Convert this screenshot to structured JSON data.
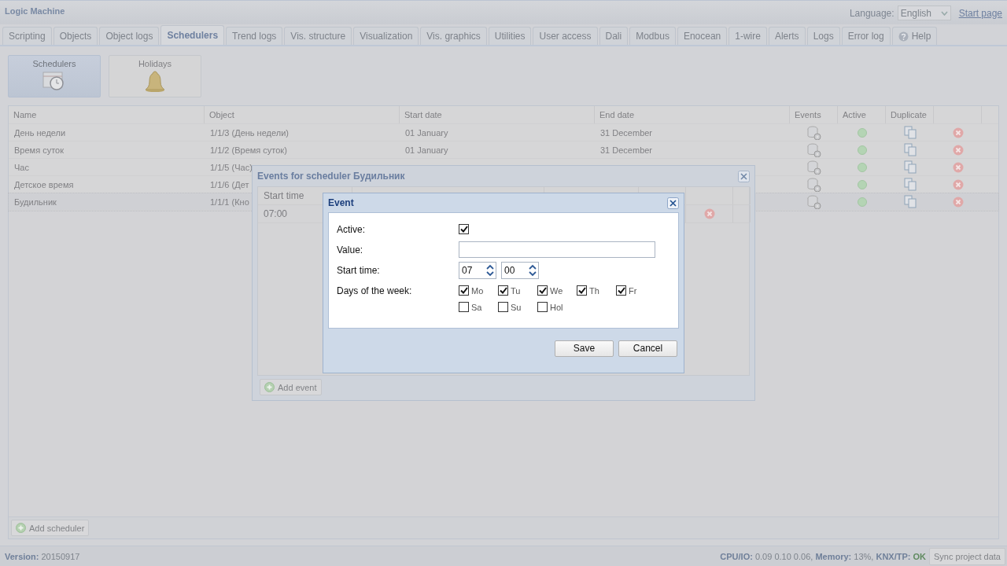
{
  "app_title": "Logic Machine",
  "language": {
    "label": "Language:",
    "value": "English"
  },
  "start_page": "Start page",
  "tabs": [
    {
      "label": "Scripting",
      "selected": false,
      "kind": "plain"
    },
    {
      "label": "Objects",
      "selected": false,
      "kind": "plain"
    },
    {
      "label": "Object logs",
      "selected": false,
      "kind": "plain"
    },
    {
      "label": "Schedulers",
      "selected": true,
      "kind": "plain"
    },
    {
      "label": "Trend logs",
      "selected": false,
      "kind": "plain"
    },
    {
      "label": "Vis. structure",
      "selected": false,
      "kind": "plain"
    },
    {
      "label": "Visualization",
      "selected": false,
      "kind": "plain"
    },
    {
      "label": "Vis. graphics",
      "selected": false,
      "kind": "plain"
    },
    {
      "label": "Utilities",
      "selected": false,
      "kind": "plain"
    },
    {
      "label": "User access",
      "selected": false,
      "kind": "plain"
    },
    {
      "label": "Dali",
      "selected": false,
      "kind": "plain"
    },
    {
      "label": "Modbus",
      "selected": false,
      "kind": "plain"
    },
    {
      "label": "Enocean",
      "selected": false,
      "kind": "plain"
    },
    {
      "label": "1-wire",
      "selected": false,
      "kind": "plain"
    },
    {
      "label": "Alerts",
      "selected": false,
      "kind": "plain"
    },
    {
      "label": "Logs",
      "selected": false,
      "kind": "plain"
    },
    {
      "label": "Error log",
      "selected": false,
      "kind": "plain"
    },
    {
      "label": "Help",
      "selected": false,
      "kind": "help"
    }
  ],
  "modules": [
    {
      "label": "Schedulers",
      "selected": true,
      "kind": "calendar"
    },
    {
      "label": "Holidays",
      "selected": false,
      "kind": "bell"
    }
  ],
  "table": {
    "columns": [
      "Name",
      "Object",
      "Start date",
      "End date",
      "Events",
      "Active",
      "Duplicate"
    ],
    "rows": [
      {
        "name": "День недели",
        "object": "1/1/3 (День недели)",
        "start_date": "01 January",
        "end_date": "31 December",
        "active": true,
        "selected": false
      },
      {
        "name": "Время суток",
        "object": "1/1/2 (Время суток)",
        "start_date": "01 January",
        "end_date": "31 December",
        "active": true,
        "selected": false
      },
      {
        "name": "Час",
        "object": "1/1/5 (Час)",
        "active": true,
        "selected": false
      },
      {
        "name": "Детское время",
        "object": "1/1/6 (Дет",
        "active": true,
        "selected": false
      },
      {
        "name": "Будильник",
        "object": "1/1/1 (Кно",
        "active": true,
        "selected": true
      }
    ]
  },
  "add_scheduler": "Add scheduler",
  "events_window": {
    "title": "Events for scheduler Будильник",
    "columns": [
      "Start time"
    ],
    "rows": [
      {
        "start_time": "07:00"
      }
    ],
    "add_button": "Add event"
  },
  "event_dialog": {
    "title": "Event",
    "active": {
      "label": "Active:",
      "checked": true
    },
    "value": {
      "label": "Value:"
    },
    "start_time": {
      "label": "Start time:",
      "hour": "07",
      "minute": "00"
    },
    "days_label": "Days of the week:",
    "days": [
      {
        "label": "Mo",
        "checked": true
      },
      {
        "label": "Tu",
        "checked": true
      },
      {
        "label": "We",
        "checked": true
      },
      {
        "label": "Th",
        "checked": true
      },
      {
        "label": "Fr",
        "checked": true
      },
      {
        "label": "Sa",
        "checked": false
      },
      {
        "label": "Su",
        "checked": false
      },
      {
        "label": "Hol",
        "checked": false
      }
    ],
    "buttons": [
      "Save",
      "Cancel"
    ]
  },
  "status": {
    "version_label": "Version:",
    "version": "20150917",
    "cpu_label": "CPU/IO:",
    "cpu": "0.09 0.10 0.06,",
    "memory_label": "Memory:",
    "memory": "13%,",
    "knx_label": "KNX/TP:",
    "knx": "OK",
    "sync": "Sync project data"
  }
}
